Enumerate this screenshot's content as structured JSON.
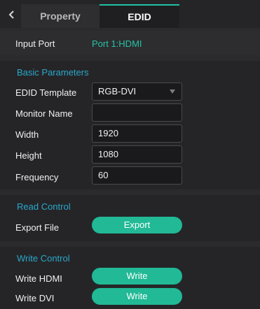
{
  "tabs": {
    "property": "Property",
    "edid": "EDID"
  },
  "input_port": {
    "label": "Input Port",
    "value": "Port 1:HDMI"
  },
  "basic": {
    "title": "Basic Parameters",
    "edid_template_label": "EDID Template",
    "edid_template_value": "RGB-DVI",
    "monitor_name_label": "Monitor Name",
    "monitor_name_value": "",
    "width_label": "Width",
    "width_value": "1920",
    "height_label": "Height",
    "height_value": "1080",
    "frequency_label": "Frequency",
    "frequency_value": "60"
  },
  "read": {
    "title": "Read Control",
    "export_label": "Export File",
    "export_button": "Export"
  },
  "write": {
    "title": "Write Control",
    "hdmi_label": "Write HDMI",
    "hdmi_button": "Write",
    "dvi_label": "Write DVI",
    "dvi_button": "Write"
  },
  "colors": {
    "accent": "#21b996",
    "section_title": "#2aa7c9",
    "port_value": "#27c2a5",
    "tab_indicator": "#1fc1a5"
  },
  "icons": {
    "back": "chevron-left-icon",
    "select": "caret-down-icon"
  }
}
